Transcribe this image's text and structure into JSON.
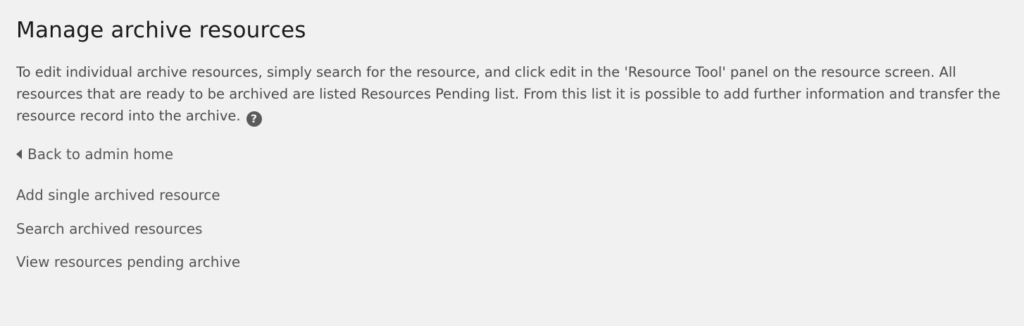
{
  "page_title": "Manage archive resources",
  "intro_text": "To edit individual archive resources, simply search for the resource, and click edit in the 'Resource Tool' panel on the resource screen. All resources that are ready to be archived are listed Resources Pending list. From this list it is possible to add further information and transfer the resource record into the archive.",
  "help_icon": {
    "icon": "question-circle-icon",
    "glyph": "?"
  },
  "back_link": {
    "icon": "caret-left-icon",
    "label": "Back to admin home"
  },
  "links": [
    {
      "label": "Add single archived resource"
    },
    {
      "label": "Search archived resources"
    },
    {
      "label": "View resources pending archive"
    }
  ],
  "colors": {
    "background": "#f1f1f1",
    "heading": "#1a1a1a",
    "text": "#4a4a4a",
    "link": "#555555"
  }
}
